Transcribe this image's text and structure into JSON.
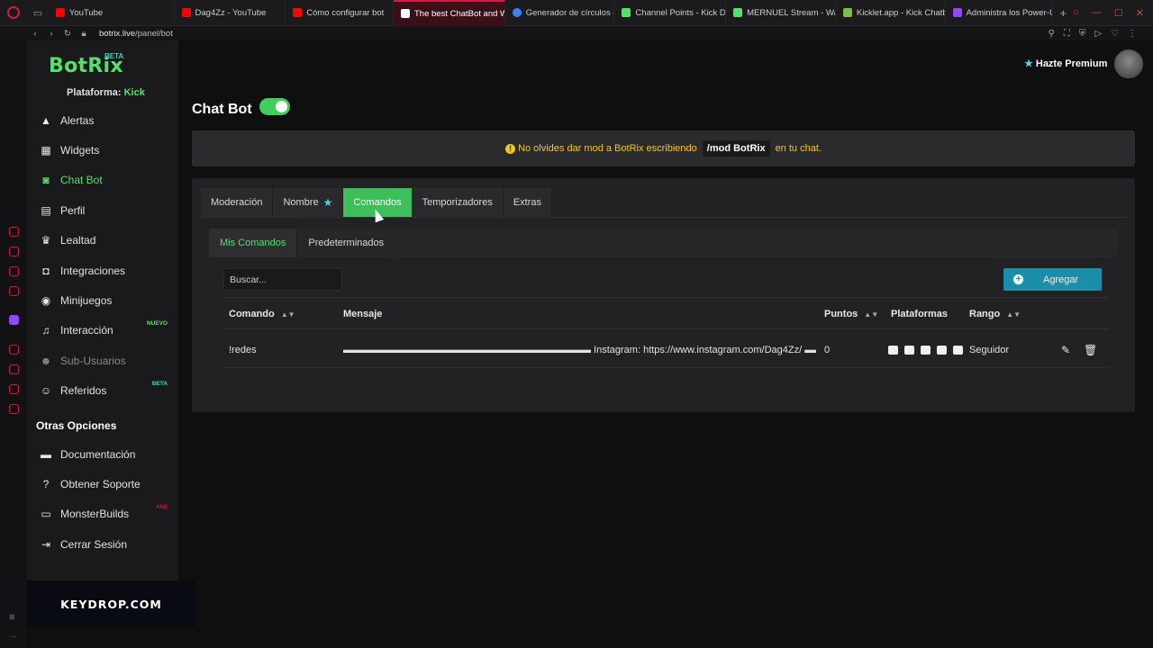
{
  "browser": {
    "tabs": [
      {
        "label": "YouTube",
        "color": "#ff0000"
      },
      {
        "label": "Dag4Zz - YouTube",
        "color": "#ff0000"
      },
      {
        "label": "Cómo configurar bot",
        "color": "#ff0000"
      },
      {
        "label": "The best ChatBot and Wid",
        "color": "#ffffff"
      },
      {
        "label": "Generador de círculos de",
        "color": "#3b82f6"
      },
      {
        "label": "Channel Points - Kick Da",
        "color": "#53e06d"
      },
      {
        "label": "MERNUEL Stream - Wat",
        "color": "#53e06d"
      },
      {
        "label": "Kicklet.app - Kick Chatb",
        "color": "#7ac143"
      },
      {
        "label": "Administra los Power-Up",
        "color": "#9146ff"
      }
    ],
    "active_tab_index": 3,
    "url_host": "botrix.live",
    "url_path": "/panel/bot"
  },
  "app": {
    "logo": "BotRix",
    "logo_badge": "BETA",
    "platform_label": "Plataforma:",
    "platform_value": "Kick",
    "premium": "Hazte Premium"
  },
  "sidebar": {
    "items": [
      {
        "label": "Alertas",
        "icon": "warning-icon"
      },
      {
        "label": "Widgets",
        "icon": "grid-icon"
      },
      {
        "label": "Chat Bot",
        "icon": "robot-icon"
      },
      {
        "label": "Perfil",
        "icon": "id-card-icon"
      },
      {
        "label": "Lealtad",
        "icon": "trophy-icon"
      },
      {
        "label": "Integraciones",
        "icon": "plug-icon"
      },
      {
        "label": "Minijuegos",
        "icon": "gamepad-icon"
      },
      {
        "label": "Interacción",
        "icon": "music-icon",
        "tag": "NUEVO"
      },
      {
        "label": "Sub-Usuarios",
        "icon": "users-icon"
      },
      {
        "label": "Referidos",
        "icon": "user-group-icon",
        "tag": "BETA"
      }
    ],
    "other_title": "Otras Opciones",
    "other_items": [
      {
        "label": "Documentación",
        "icon": "book-icon"
      },
      {
        "label": "Obtener Soporte",
        "icon": "question-icon"
      },
      {
        "label": "MonsterBuilds",
        "icon": "laptop-icon",
        "tag": "#AD"
      },
      {
        "label": "Cerrar Sesión",
        "icon": "logout-icon"
      }
    ]
  },
  "main": {
    "title": "Chat Bot",
    "notice_prefix": "No olvides dar mod a BotRix escribiendo",
    "notice_code": "/mod BotRix",
    "notice_suffix": "en tu chat.",
    "tabs": [
      "Moderación",
      "Nombre",
      "Comandos",
      "Temporizadores",
      "Extras"
    ],
    "subtabs": [
      "Mis Comandos",
      "Predeterminados"
    ],
    "search_placeholder": "Buscar...",
    "add_label": "Agregar",
    "columns": [
      "Comando",
      "Mensaje",
      "Puntos",
      "Plataformas",
      "Rango"
    ],
    "rows": [
      {
        "command": "!redes",
        "message": "▬▬▬▬▬▬▬▬▬▬▬▬▬▬▬▬▬▬▬▬▬▬▬▬▬ Instagram: https://www.instagram.com/Dag4Zz/ ▬▬▬▬▬",
        "points": "0",
        "rank": "Seguidor"
      }
    ]
  },
  "overlay": {
    "sponsor": "KEYDROP.COM"
  }
}
